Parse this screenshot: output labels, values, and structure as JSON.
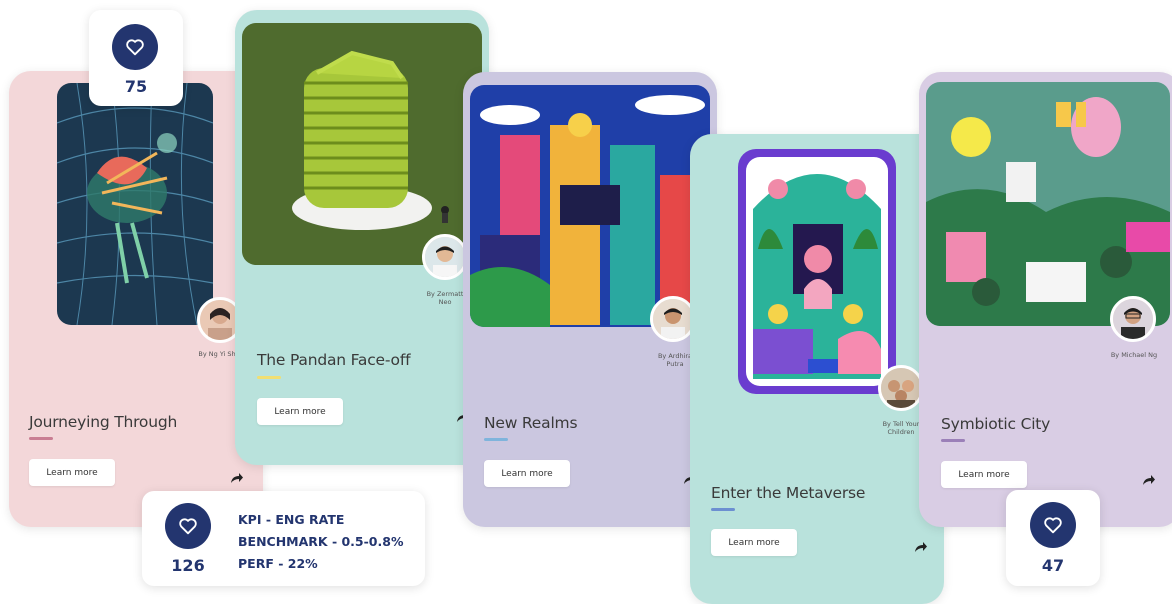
{
  "cards": [
    {
      "title": "Journeying Through",
      "button": "Learn more",
      "byline": "By Ng Yi Shian",
      "bg": "#f3d7d9",
      "accent": "#c97e93"
    },
    {
      "title": "The Pandan Face-off",
      "button": "Learn more",
      "byline": "By Zermatt Neo",
      "bg": "#b9e2dc",
      "accent": "#f1df72"
    },
    {
      "title": "New Realms",
      "button": "Learn more",
      "byline": "By Ardhira Putra",
      "bg": "#cbc7e0",
      "accent": "#7fb4dc"
    },
    {
      "title": "Enter the Metaverse",
      "button": "Learn more",
      "byline": "By Tell Your Children",
      "bg": "#b9e2dc",
      "accent": "#6c8fd1"
    },
    {
      "title": "Symbiotic City",
      "button": "Learn more",
      "byline": "By Michael Ng",
      "bg": "#d9cde4",
      "accent": "#9b80b8"
    }
  ],
  "likes": [
    {
      "count": "75"
    },
    {
      "count": "126",
      "kpi": [
        "KPI - ENG RATE",
        "BENCHMARK - 0.5-0.8%",
        "PERF - 22%"
      ]
    },
    {
      "count": "47"
    }
  ],
  "icons": {
    "like": "heart-icon",
    "share": "share-arrow-icon"
  },
  "colors": {
    "like_badge": "#23356f"
  }
}
